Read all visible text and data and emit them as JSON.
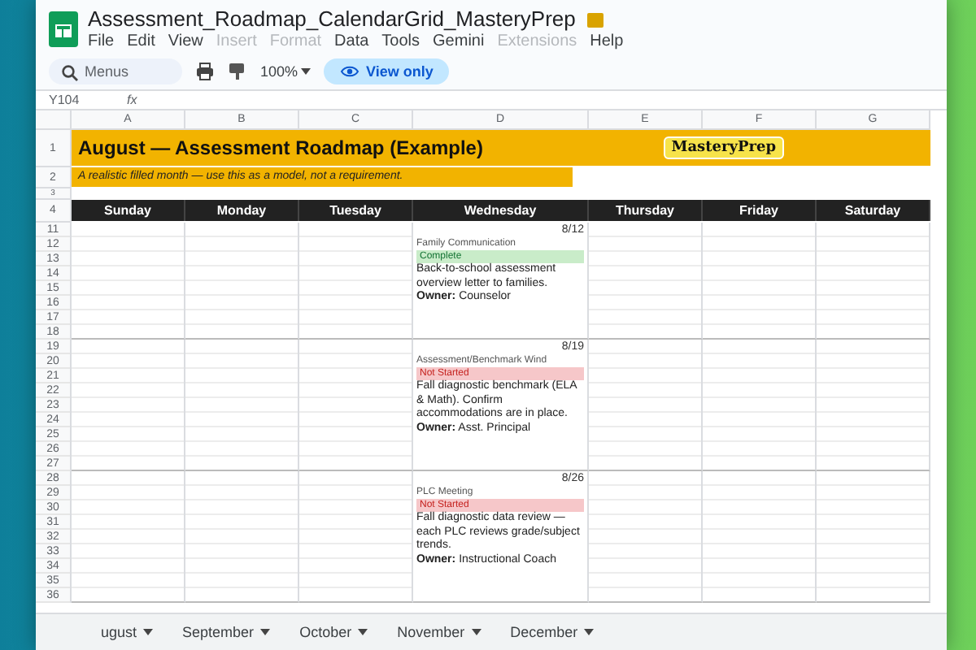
{
  "window": {
    "title": "Assessment_Roadmap_CalendarGrid_MasteryPrep",
    "menu": [
      {
        "label": "File",
        "disabled": false
      },
      {
        "label": "Edit",
        "disabled": false
      },
      {
        "label": "View",
        "disabled": false
      },
      {
        "label": "Insert",
        "disabled": true
      },
      {
        "label": "Format",
        "disabled": true
      },
      {
        "label": "Data",
        "disabled": false
      },
      {
        "label": "Tools",
        "disabled": false
      },
      {
        "label": "Gemini",
        "disabled": false
      },
      {
        "label": "Extensions",
        "disabled": true
      },
      {
        "label": "Help",
        "disabled": false
      }
    ]
  },
  "toolbar": {
    "search": {
      "placeholder": "Menus"
    },
    "zoom": "100%",
    "view_mode": "View only"
  },
  "formula_bar": {
    "cell_ref": "Y104",
    "fx": "fx"
  },
  "columns": [
    "A",
    "B",
    "C",
    "D",
    "E",
    "F",
    "G"
  ],
  "sheet": {
    "title": "August — Assessment Roadmap (Example)",
    "subtitle": "A realistic filled month — use this as a model, not a requirement.",
    "logo": "MasteryPrep",
    "header_rows": [
      "1",
      "2",
      "3",
      "4"
    ],
    "days": [
      "Sunday",
      "Monday",
      "Tuesday",
      "Wednesday",
      "Thursday",
      "Friday",
      "Saturday"
    ],
    "weeks": [
      {
        "rows": [
          "11",
          "12",
          "13",
          "14",
          "15",
          "16",
          "17",
          "18"
        ],
        "date": "8/12",
        "event": {
          "category": "Family Communication",
          "status": "Complete",
          "kind": "complete",
          "description": "Back-to-school assessment overview letter to families.",
          "owner": "**Owner:** Counselor"
        }
      },
      {
        "rows": [
          "19",
          "20",
          "21",
          "22",
          "23",
          "24",
          "25",
          "26",
          "27"
        ],
        "date": "8/19",
        "event": {
          "category": "Assessment/Benchmark Wind",
          "status": "Not Started",
          "kind": "not_started",
          "description": "Fall diagnostic benchmark (ELA & Math). Confirm accommodations are in place.",
          "owner": "**Owner:** Asst. Principal"
        }
      },
      {
        "rows": [
          "28",
          "29",
          "30",
          "31",
          "32",
          "33",
          "34",
          "35",
          "36"
        ],
        "date": "8/26",
        "event": {
          "category": "PLC Meeting",
          "status": "Not Started",
          "kind": "not_started",
          "description": "Fall diagnostic data review — each PLC reviews grade/subject trends.",
          "owner": "**Owner:** Instructional Coach"
        }
      }
    ]
  },
  "sheet_tabs": [
    {
      "label": "ugust"
    },
    {
      "label": "September"
    },
    {
      "label": "October"
    },
    {
      "label": "November"
    },
    {
      "label": "December"
    }
  ]
}
